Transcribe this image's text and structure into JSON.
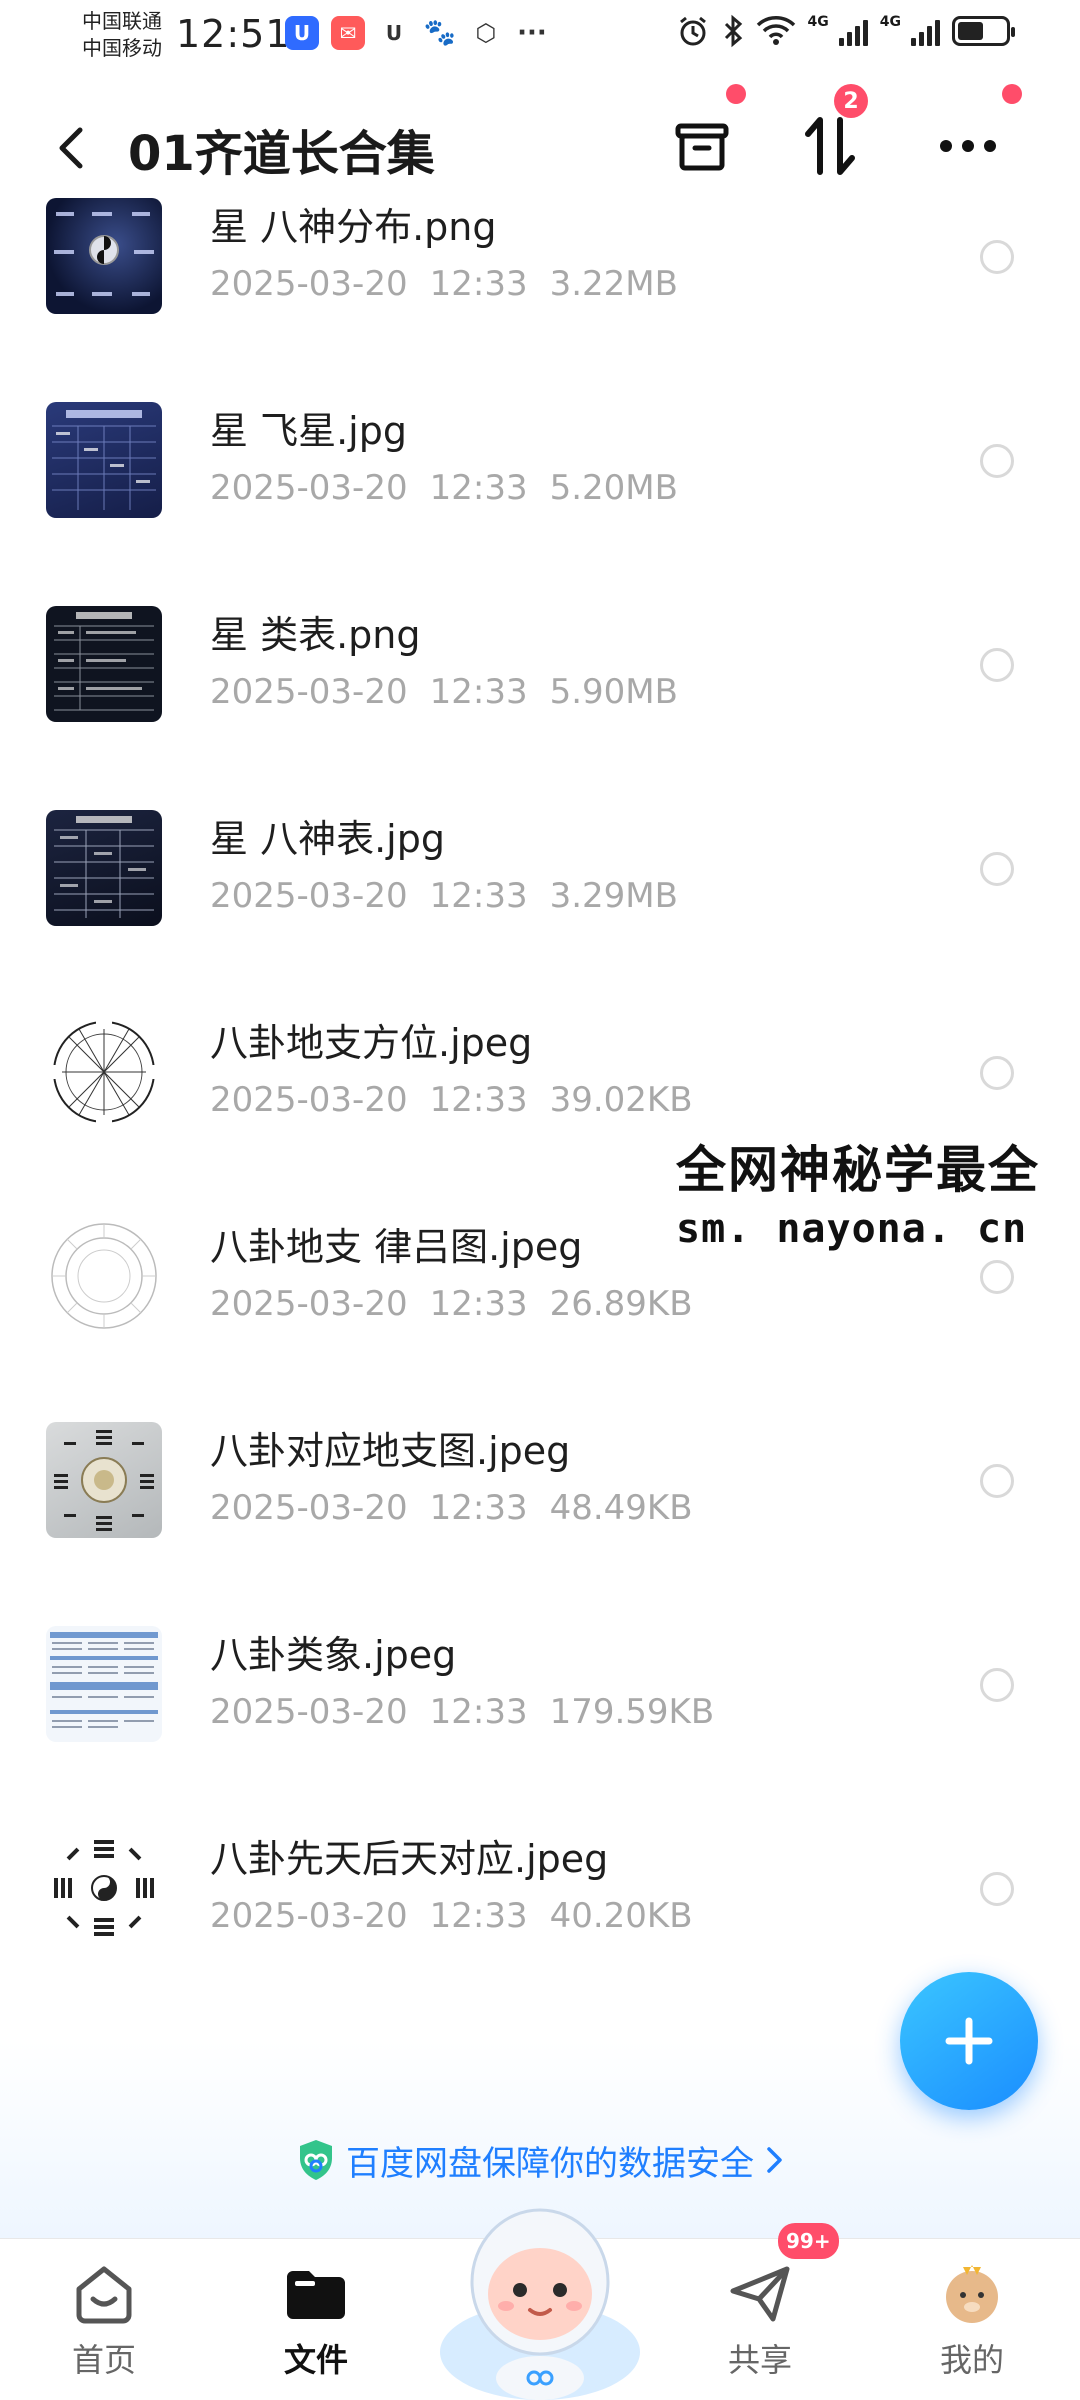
{
  "status_bar": {
    "carrier_1": "中国联通",
    "carrier_2": "中国移动",
    "time": "12:51",
    "network_1": "4G",
    "network_2": "4G"
  },
  "header": {
    "title": "01齐道长合集",
    "transfer_badge": "2"
  },
  "files": [
    {
      "name": "星 八神分布.png",
      "date": "2025-03-20",
      "time": "12:33",
      "size": "3.22MB",
      "thumb": "star-map-dark"
    },
    {
      "name": "星 飞星.jpg",
      "date": "2025-03-20",
      "time": "12:33",
      "size": "5.20MB",
      "thumb": "star-table-dark"
    },
    {
      "name": "星 类表.png",
      "date": "2025-03-20",
      "time": "12:33",
      "size": "5.90MB",
      "thumb": "star-list-dark"
    },
    {
      "name": "星 八神表.jpg",
      "date": "2025-03-20",
      "time": "12:33",
      "size": "3.29MB",
      "thumb": "star-grid-dark"
    },
    {
      "name": "八卦地支方位.jpeg",
      "date": "2025-03-20",
      "time": "12:33",
      "size": "39.02KB",
      "thumb": "compass-wheel"
    },
    {
      "name": "八卦地支 律吕图.jpeg",
      "date": "2025-03-20",
      "time": "12:33",
      "size": "26.89KB",
      "thumb": "ring-diagram"
    },
    {
      "name": "八卦对应地支图.jpeg",
      "date": "2025-03-20",
      "time": "12:33",
      "size": "48.49KB",
      "thumb": "bagua-photo"
    },
    {
      "name": "八卦类象.jpeg",
      "date": "2025-03-20",
      "time": "12:33",
      "size": "179.59KB",
      "thumb": "blue-table"
    },
    {
      "name": "八卦先天后天对应.jpeg",
      "date": "2025-03-20",
      "time": "12:33",
      "size": "40.20KB",
      "thumb": "bagua-trigrams"
    }
  ],
  "watermark": {
    "line1": "全网神秘学最全",
    "line2": "sm. nayona. cn"
  },
  "security_notice": "百度网盘保障你的数据安全",
  "tabs": [
    {
      "label": "首页",
      "icon": "home-icon"
    },
    {
      "label": "文件",
      "icon": "folder-icon"
    },
    {
      "label": "共享",
      "icon": "paper-plane-icon",
      "badge": "99+"
    },
    {
      "label": "我的",
      "icon": "avatar-icon"
    }
  ],
  "colors": {
    "accent": "#1f7fff",
    "badge": "#ff4d6a",
    "meta_text": "#a8a8a8"
  }
}
